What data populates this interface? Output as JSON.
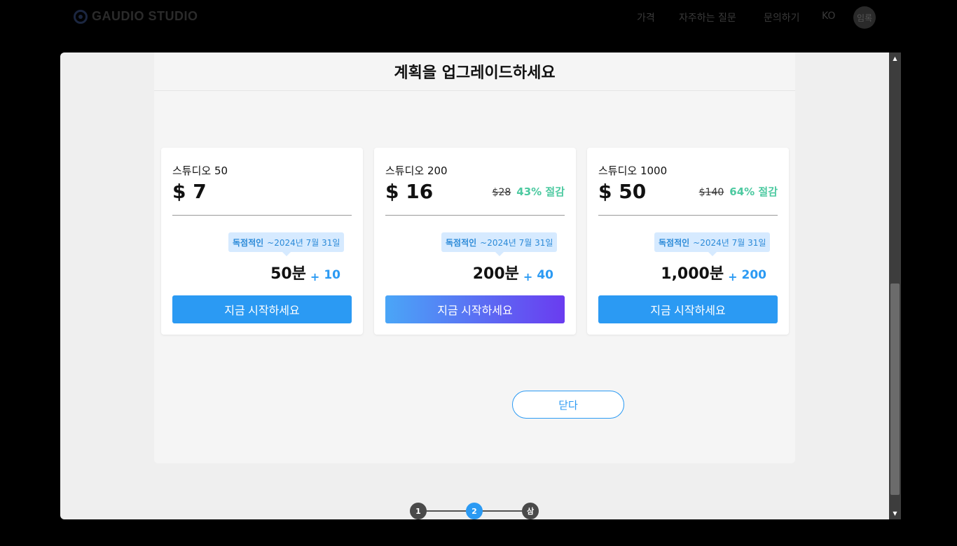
{
  "header": {
    "logo_text": "GAUDIO STUDIO",
    "nav": [
      {
        "label": "가격"
      },
      {
        "label": "자주하는 질문"
      },
      {
        "label": "문의하기"
      },
      {
        "label": "KO"
      }
    ],
    "avatar_text": "임록"
  },
  "modal": {
    "title": "계획을 업그레이드하세요",
    "plans": [
      {
        "name": "스튜디오 50",
        "price": "$ 7",
        "original_price": "",
        "discount": "",
        "tooltip_label": "독점적인",
        "tooltip_date": "~2024년 7월 31일",
        "minutes": "50분",
        "plus": "+",
        "bonus": "10",
        "cta": "지금 시작하세요"
      },
      {
        "name": "스튜디오 200",
        "price": "$ 16",
        "original_price": "$28",
        "discount": "43% 절감",
        "tooltip_label": "독점적인",
        "tooltip_date": "~2024년 7월 31일",
        "minutes": "200분",
        "plus": "+",
        "bonus": "40",
        "cta": "지금 시작하세요"
      },
      {
        "name": "스튜디오 1000",
        "price": "$ 50",
        "original_price": "$140",
        "discount": "64% 절감",
        "tooltip_label": "독점적인",
        "tooltip_date": "~2024년 7월 31일",
        "minutes": "1,000분",
        "plus": "+",
        "bonus": "200",
        "cta": "지금 시작하세요"
      }
    ],
    "close_label": "닫다",
    "steps": [
      "1",
      "2",
      "삼"
    ],
    "active_step": 2
  },
  "colors": {
    "accent": "#2b9af3",
    "savings": "#4cc9a0",
    "gradient_start": "#4aa6f7",
    "gradient_end": "#6a3cf0"
  }
}
